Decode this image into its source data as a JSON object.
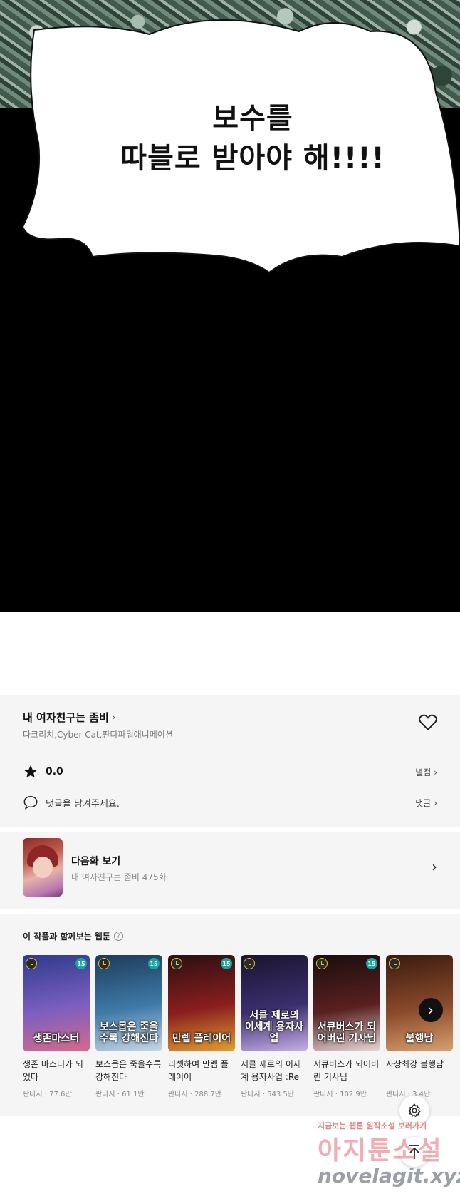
{
  "comic": {
    "speech_line1": "보수를",
    "speech_line2": "따블로 받아야 해!!!!"
  },
  "series": {
    "title": "내 여자친구는 좀비",
    "authors": "다크리치,Cyber Cat,판다파워애니메이션",
    "rating": "0.0",
    "rate_link": "별점",
    "comment_placeholder": "댓글을 남겨주세요.",
    "comment_link": "댓글"
  },
  "next_episode": {
    "label": "다음화 보기",
    "subtitle": "내 여자친구는 좀비 475화"
  },
  "recommendations": {
    "heading": "이 작품과 함께보는 웹툰",
    "items": [
      {
        "title": "생존 마스터가 되었다",
        "meta": "판타지 · 77.6만",
        "cover_text": "생존마스터",
        "age": "15",
        "colors": [
          "#2d3a8c",
          "#7a5fc0",
          "#d66a8a"
        ]
      },
      {
        "title": "보스몹은 죽을수록 강해진다",
        "meta": "판타지 · 61.1만",
        "cover_text": "보스몹은 죽을수록 강해진다",
        "age": "15",
        "colors": [
          "#1d3b5a",
          "#3f7aa8",
          "#c9d8e6"
        ]
      },
      {
        "title": "리셋하여 만렙 플레이어",
        "meta": "판타지 · 288.7만",
        "cover_text": "만렙 플레이어",
        "age": "15",
        "colors": [
          "#2a0f12",
          "#8a1e1e",
          "#e0a030"
        ]
      },
      {
        "title": "서클 제로의 이세계 용자사업 :Re",
        "meta": "판타지 · 543.5만",
        "cover_text": "서클 제로의 이세계 용자사업",
        "age": "",
        "colors": [
          "#1a1430",
          "#3b2f6e",
          "#c7b0e8"
        ]
      },
      {
        "title": "서큐버스가 되어버린 기사님",
        "meta": "판타지 · 102.9만",
        "cover_text": "서큐버스가 되어버린 기사님",
        "age": "15",
        "colors": [
          "#1a0d0d",
          "#5a2020",
          "#e8d8d8"
        ]
      },
      {
        "title": "사상최강 불행남",
        "meta": "판타지 · 3.4만",
        "cover_text": "불행남",
        "age": "",
        "colors": [
          "#3a1a10",
          "#8a4a2a",
          "#d8a070"
        ]
      }
    ]
  },
  "watermark": {
    "line1": "지금보는 웹툰 원작소설 보러가기",
    "line2": "아지툰소설",
    "line3": "novelagit.xyz"
  }
}
